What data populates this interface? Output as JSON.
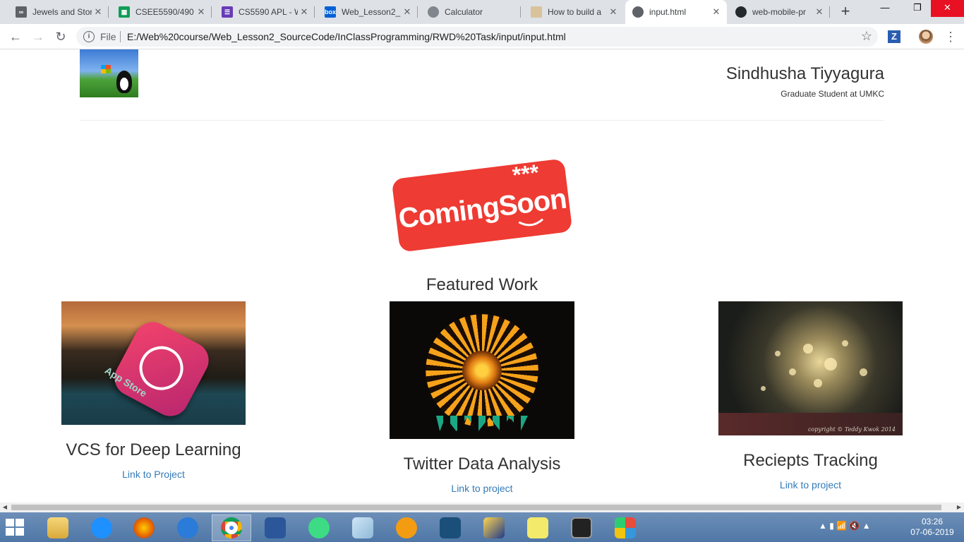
{
  "browser": {
    "tabs": [
      {
        "title": "Jewels and Stor",
        "favicon_color": "#5f6368",
        "favicon": "link-icon"
      },
      {
        "title": "CSEE5590/490",
        "favicon_color": "#0f9d58",
        "favicon": "sheets-icon"
      },
      {
        "title": "CS5590 APL - W",
        "favicon_color": "#673ab7",
        "favicon": "forms-icon"
      },
      {
        "title": "Web_Lesson2_",
        "favicon_color": "#0061d5",
        "favicon": "box-icon"
      },
      {
        "title": "Calculator",
        "favicon_color": "#80868b",
        "favicon": "globe-icon"
      },
      {
        "title": "How to build a",
        "favicon_color": "#d8c39a",
        "favicon": "page-icon"
      },
      {
        "title": "input.html",
        "favicon_color": "#5f6368",
        "favicon": "globe-icon",
        "active": true
      },
      {
        "title": "web-mobile-pr",
        "favicon_color": "#24292e",
        "favicon": "github-icon"
      }
    ],
    "new_tab_glyph": "+",
    "omnibox": {
      "scheme_label": "File",
      "url": "E:/Web%20course/Web_Lesson2_SourceCode/InClassProgramming/RWD%20Task/input/input.html"
    },
    "extension_label": "Z"
  },
  "page": {
    "header": {
      "name": "Sindhusha Tiyyagura",
      "subtitle": "Graduate Student at UMKC"
    },
    "coming_soon": {
      "text": "ComingSoon",
      "stars": "***",
      "badge_color": "#ee3b33"
    },
    "featured_title": "Featured Work",
    "projects": [
      {
        "title": "VCS for Deep Learning",
        "link": "Link to Project",
        "image": "app-store-image",
        "image_label": "App Store"
      },
      {
        "title": "Twitter Data Analysis",
        "link": "Link to project",
        "image": "sunflower-image"
      },
      {
        "title": "Reciepts Tracking",
        "link": "Link to project",
        "image": "bokeh-trees-image",
        "image_caption": "copyright © Teddy Kwok 2014"
      }
    ],
    "link_color": "#337ab7"
  },
  "taskbar": {
    "clock_time": "03:26",
    "clock_date": "07-06-2019",
    "pinned": [
      "file-explorer-icon",
      "internet-explorer-icon",
      "firefox-icon",
      "app-icon",
      "chrome-icon",
      "word-icon",
      "android-studio-icon",
      "notepad-icon",
      "settings-wheel-icon",
      "brackets-icon",
      "network-icon",
      "sticky-notes-icon",
      "terminal-icon",
      "paint-icon"
    ]
  }
}
